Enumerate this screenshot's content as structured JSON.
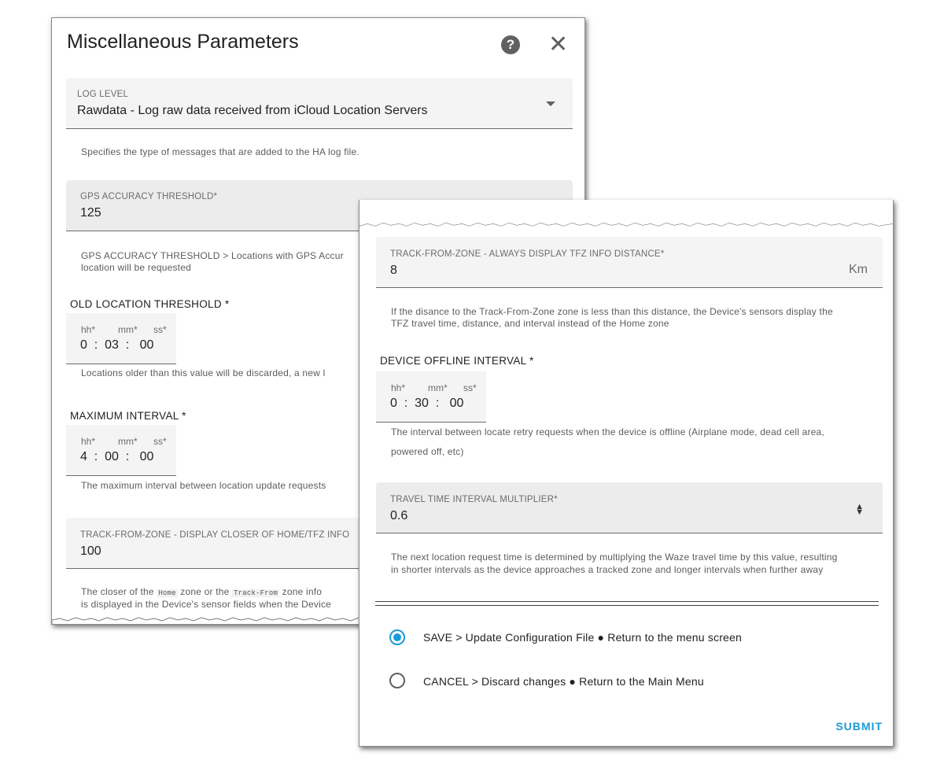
{
  "dialog": {
    "title": "Miscellaneous Parameters",
    "help_icon": "?",
    "close_icon": "✕"
  },
  "log_level": {
    "label": "LOG LEVEL",
    "value": "Rawdata - Log raw data received from iCloud Location Servers",
    "help": "Specifies the type of messages that are added to the HA log file."
  },
  "gps_accuracy": {
    "label": "GPS ACCURACY THRESHOLD*",
    "value": "125",
    "help_line1": "GPS ACCURACY THRESHOLD > Locations with GPS Accur",
    "help_line2": "location will be requested"
  },
  "old_location": {
    "title": "OLD LOCATION THRESHOLD *",
    "hh_label": "hh*",
    "mm_label": "mm*",
    "ss_label": "ss*",
    "time": "0  :  03  :   00",
    "help": "Locations older than this value will be discarded, a new l"
  },
  "max_interval": {
    "title": "MAXIMUM INTERVAL *",
    "hh_label": "hh*",
    "mm_label": "mm*",
    "ss_label": "ss*",
    "time": "4  :  00  :   00",
    "help": "The maximum interval between location update requests"
  },
  "tfz_closer": {
    "label": "TRACK-FROM-ZONE - DISPLAY CLOSER OF HOME/TFZ INFO",
    "value": "100",
    "help_a": "The closer of the",
    "code_home": "Home",
    "help_b": "zone or the",
    "code_track": "Track-From",
    "help_c": "zone info",
    "help_line2": "is displayed in the Device's sensor fields when the Device"
  },
  "tfz_distance": {
    "label": "TRACK-FROM-ZONE - ALWAYS DISPLAY TFZ INFO DISTANCE*",
    "value": "8",
    "unit": "Km",
    "help_line1": "If the disance to the Track-From-Zone zone is less than this distance, the Device's sensors display the",
    "help_line2": "TFZ travel time, distance, and interval instead of the Home zone"
  },
  "offline_interval": {
    "title": "DEVICE OFFLINE INTERVAL *",
    "hh_label": "hh*",
    "mm_label": "mm*",
    "ss_label": "ss*",
    "time": "0  :  30  :   00",
    "help_line1": "The interval between locate retry requests when the device is offline (Airplane mode, dead cell area,",
    "help_line2": "powered off, etc)"
  },
  "travel_multiplier": {
    "label": "TRAVEL TIME INTERVAL MULTIPLIER*",
    "value": "0.6",
    "help_line1": "The next location request time is determined by multiplying the Waze travel time by this value, resulting",
    "help_line2": "in shorter intervals as the device approaches a tracked zone and longer intervals when further away"
  },
  "actions": {
    "save_label": "SAVE > Update Configuration File ● Return to the menu screen",
    "save_selected": true,
    "cancel_label": "CANCEL > Discard changes ● Return to the Main Menu",
    "submit_label": "SUBMIT"
  },
  "colors": {
    "accent": "#1a9ad6",
    "field_bg": "#f4f4f4"
  }
}
